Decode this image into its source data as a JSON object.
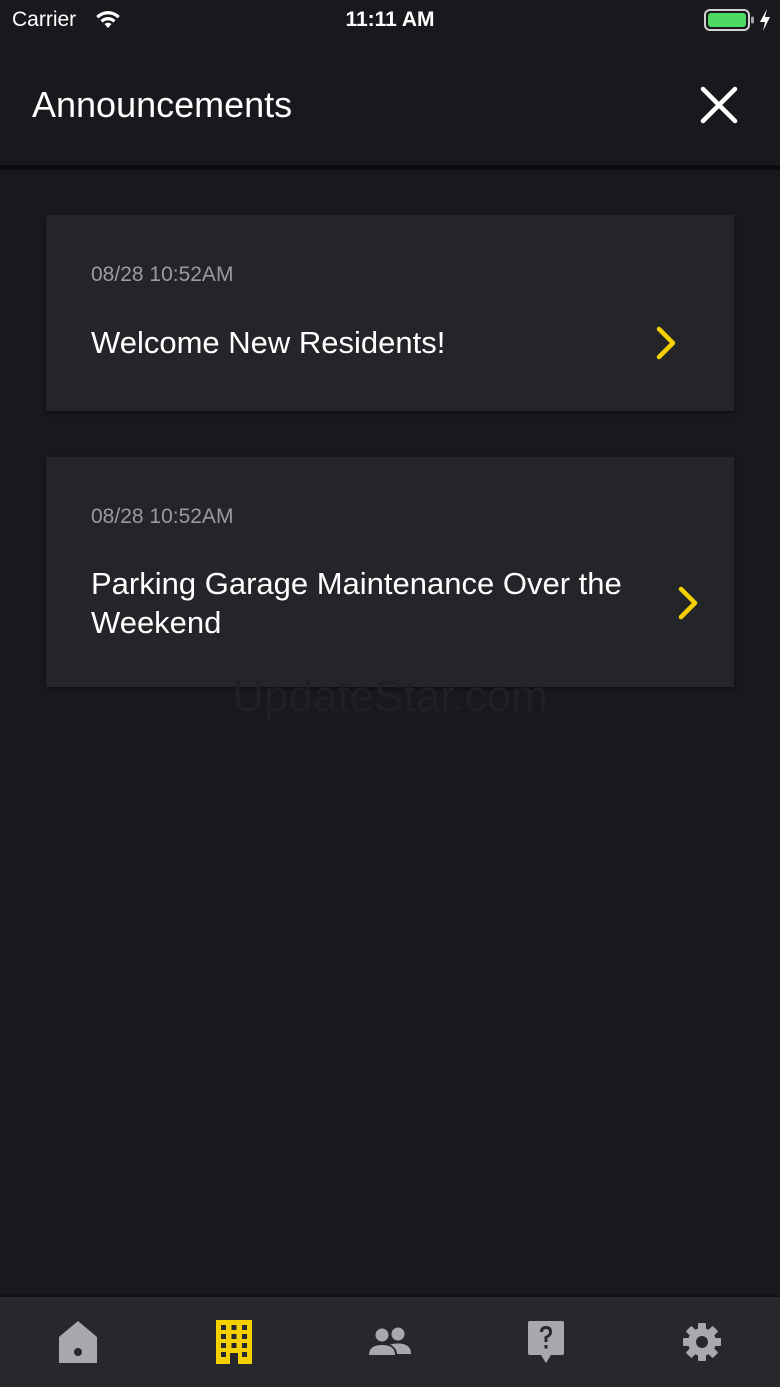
{
  "status_bar": {
    "carrier": "Carrier",
    "time": "11:11 AM",
    "battery_color": "#4cd964"
  },
  "header": {
    "title": "Announcements",
    "close_icon": "close-icon"
  },
  "announcements": [
    {
      "date": "08/28 10:52AM",
      "title": "Welcome New Residents!"
    },
    {
      "date": "08/28 10:52AM",
      "title": "Parking Garage Maintenance Over the Weekend"
    }
  ],
  "watermark": "UpdateStar.com",
  "tab_bar": {
    "tabs": [
      {
        "icon": "home-icon",
        "active": false
      },
      {
        "icon": "building-icon",
        "active": true
      },
      {
        "icon": "people-icon",
        "active": false
      },
      {
        "icon": "help-icon",
        "active": false
      },
      {
        "icon": "settings-icon",
        "active": false
      }
    ]
  },
  "colors": {
    "background": "#18191d",
    "card": "#242529",
    "accent": "#f5d000",
    "inactive_icon": "#a8a9ad",
    "secondary_text": "#9a9ba0"
  }
}
